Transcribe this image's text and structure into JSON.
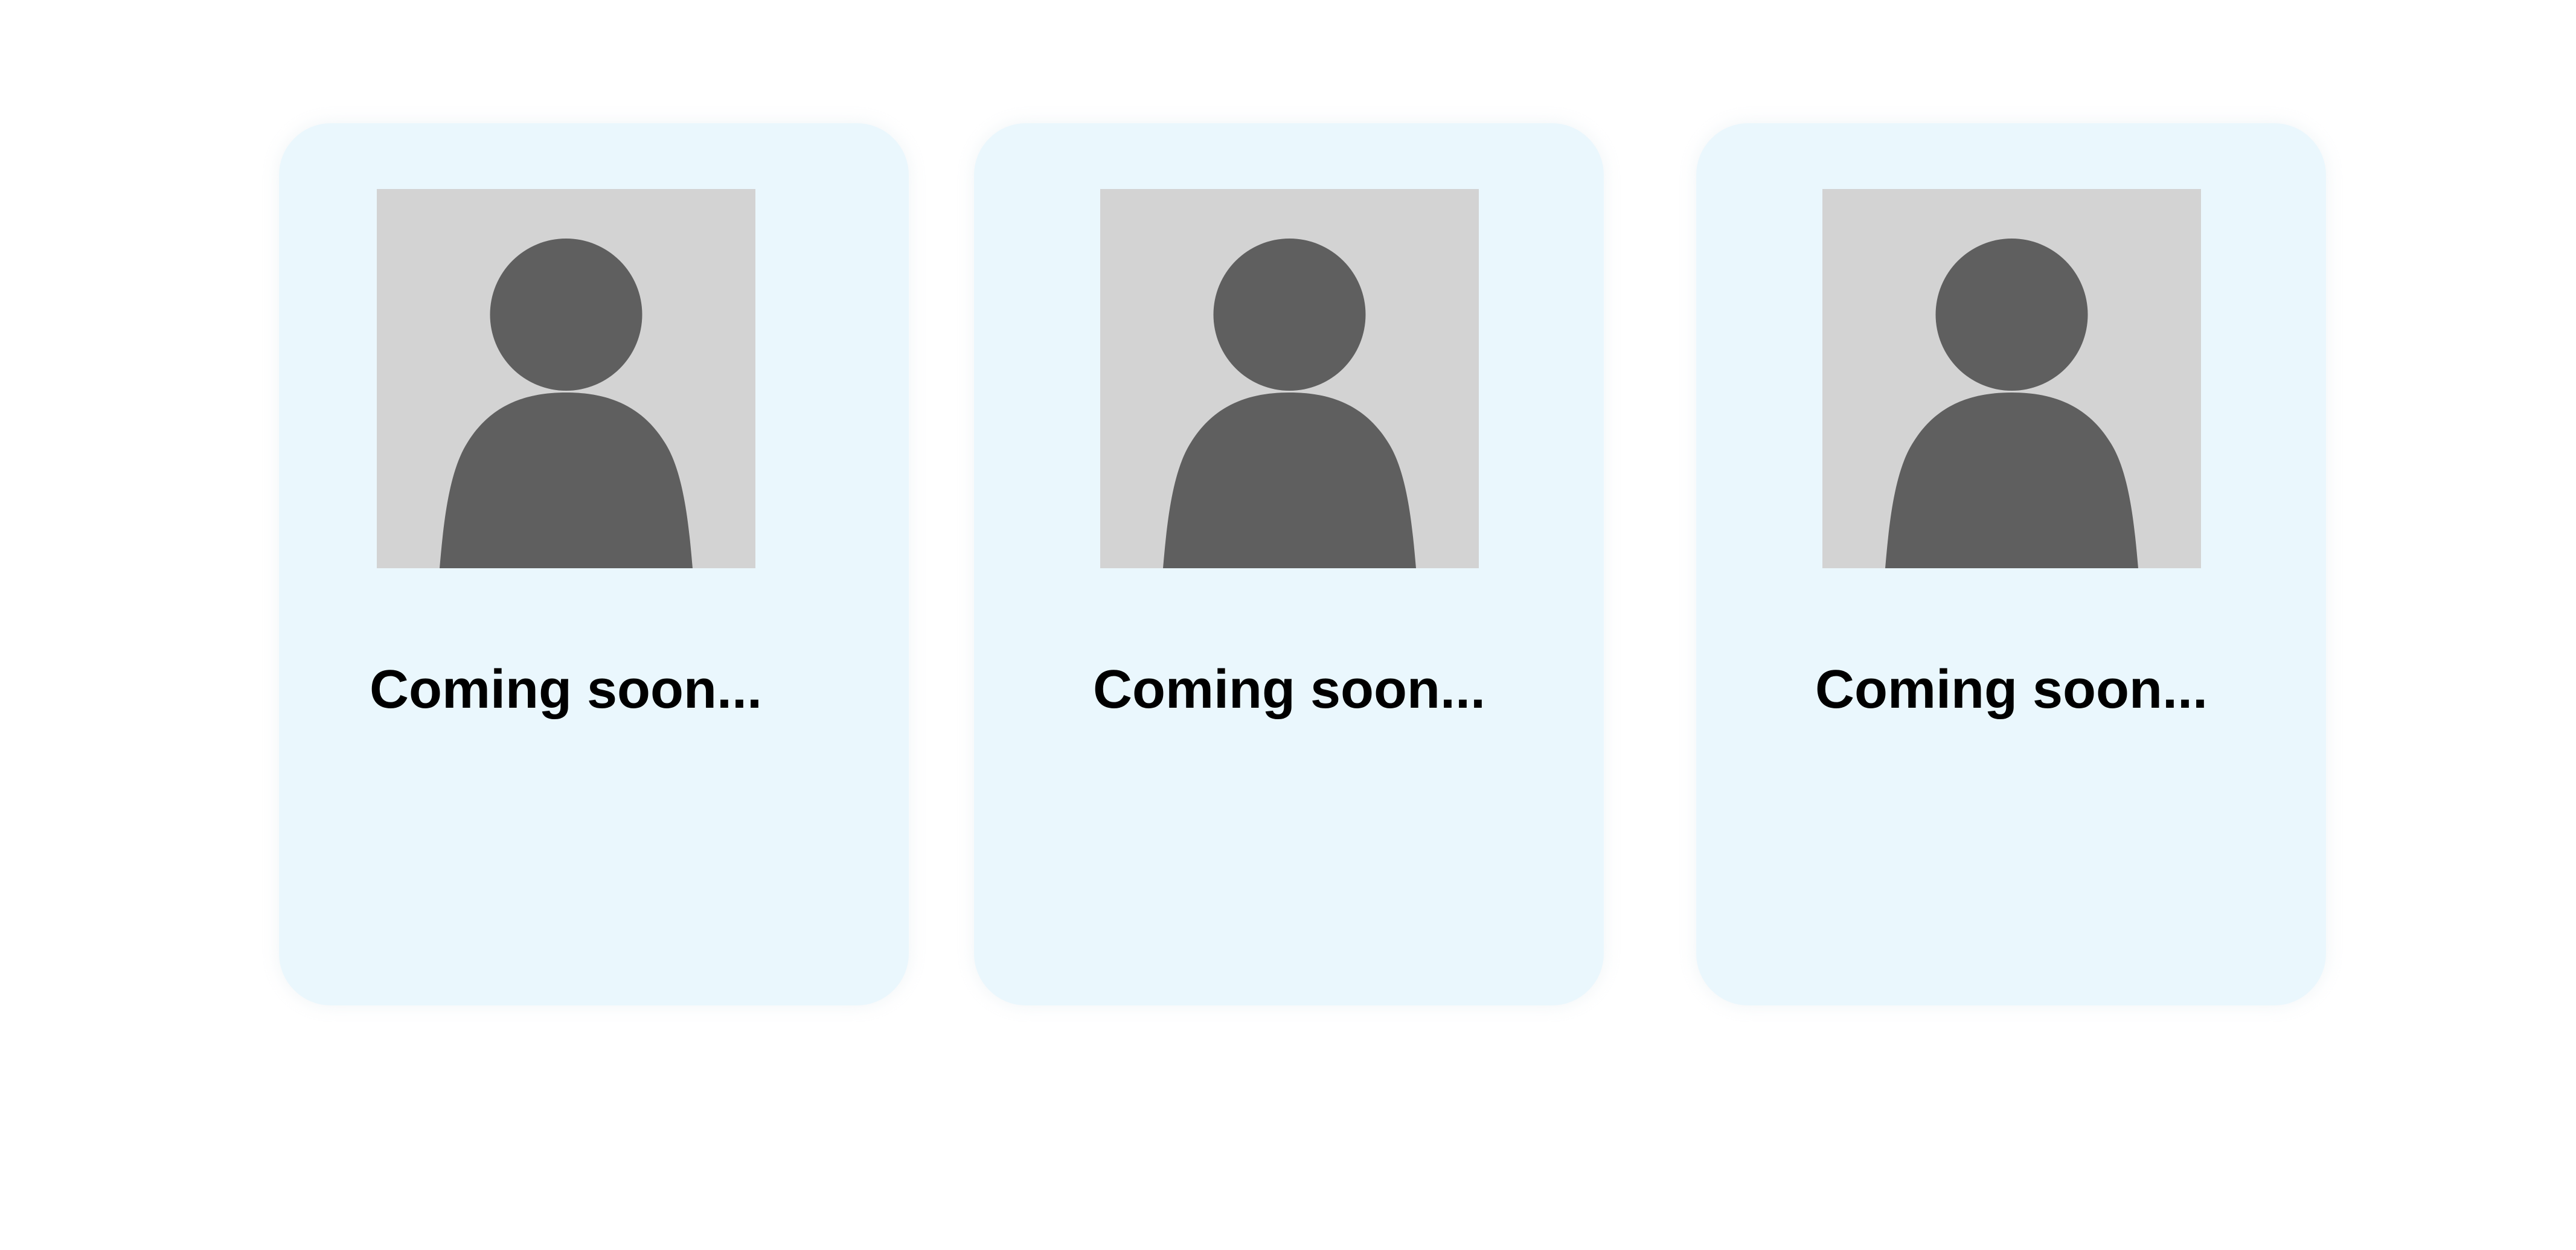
{
  "cards": [
    {
      "caption": "Coming soon...",
      "image_icon": "person-placeholder-icon"
    },
    {
      "caption": "Coming soon...",
      "image_icon": "person-placeholder-icon"
    },
    {
      "caption": "Coming soon...",
      "image_icon": "person-placeholder-icon"
    }
  ],
  "colors": {
    "card_background": "#eaf7fd",
    "placeholder_background": "#d3d3d3",
    "placeholder_figure": "#5f5f5f",
    "caption_text": "#000000"
  }
}
